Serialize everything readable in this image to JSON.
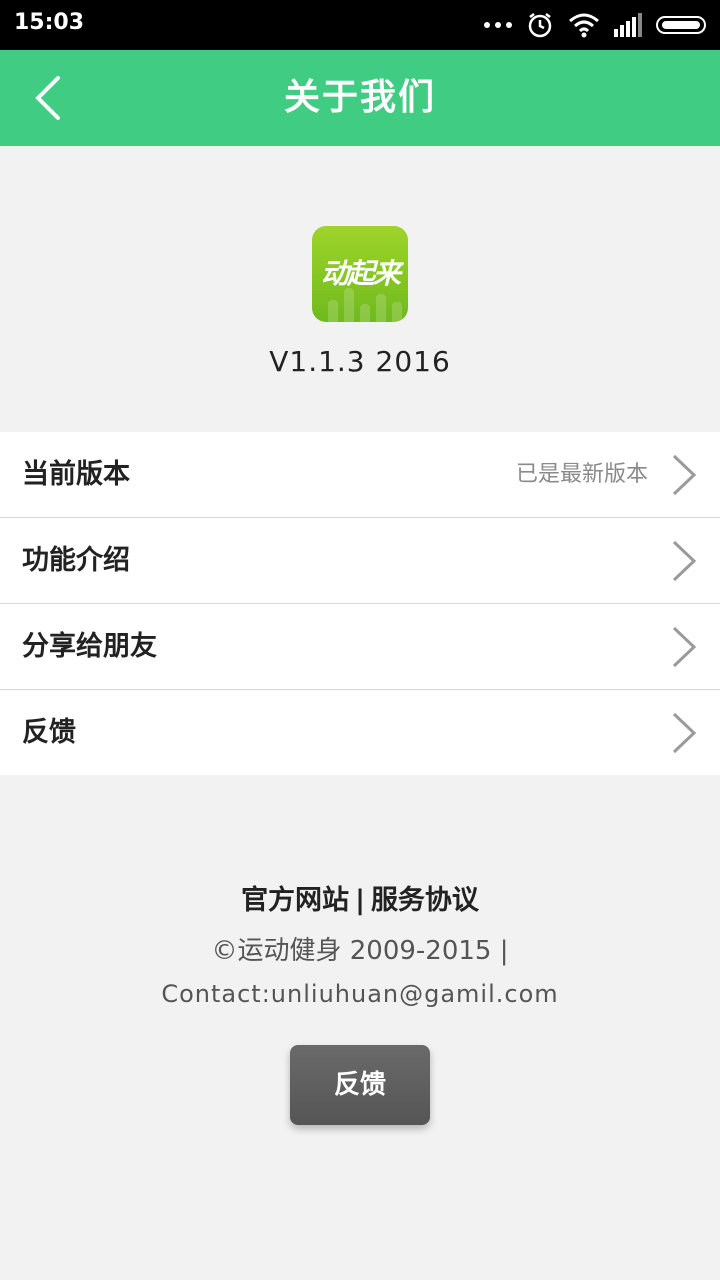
{
  "status_bar": {
    "time": "15:03",
    "icons": [
      "more-dots-icon",
      "alarm-icon",
      "wifi-icon",
      "signal-icon",
      "battery-icon"
    ]
  },
  "header": {
    "title": "关于我们",
    "back_icon": "chevron-left-icon",
    "color": "#41cc83"
  },
  "app": {
    "logo_text": "动起来",
    "version": "V1.1.3 2016"
  },
  "menu": {
    "items": [
      {
        "label": "当前版本",
        "value": "已是最新版本"
      },
      {
        "label": "功能介绍",
        "value": ""
      },
      {
        "label": "分享给朋友",
        "value": ""
      },
      {
        "label": "反馈",
        "value": ""
      }
    ]
  },
  "footer": {
    "website": "官方网站",
    "separator": "|",
    "terms": "服务协议",
    "copyright": "©运动健身 2009-2015 |",
    "contact": "Contact:unliuhuan@gamil.com",
    "feedback_button": "反馈"
  }
}
